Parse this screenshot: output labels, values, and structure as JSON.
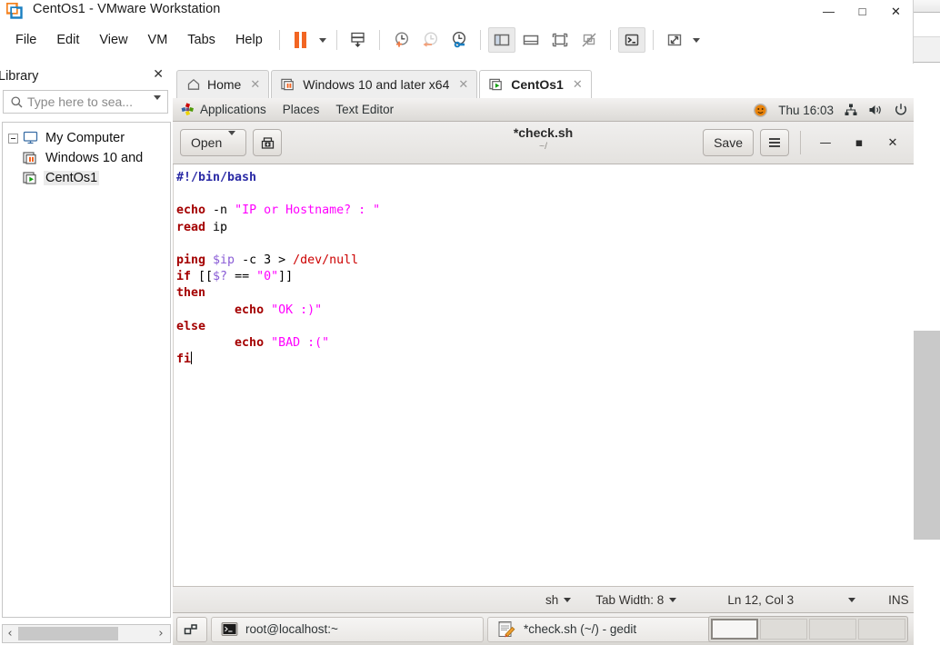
{
  "vmware": {
    "title": "CentOs1 - VMware Workstation",
    "window_buttons": [
      {
        "name": "minimize",
        "glyph": "—"
      },
      {
        "name": "maximize",
        "glyph": "□"
      },
      {
        "name": "close",
        "glyph": "✕"
      }
    ],
    "menus": [
      "File",
      "Edit",
      "View",
      "VM",
      "Tabs",
      "Help"
    ],
    "toolbar_icons": [
      "pause-icon",
      "power-dropdown-caret",
      "snapshot-manager-icon",
      "take-snapshot-icon",
      "revert-snapshot-icon",
      "manage-snapshots-icon",
      "show-library-icon",
      "show-thumbnails-icon",
      "full-screen-icon",
      "unity-mode-icon",
      "console-view-icon",
      "stretch-guest-icon",
      "stretch-dropdown-caret"
    ]
  },
  "library": {
    "title": "Library",
    "close_label": "✕",
    "search_placeholder": "Type here to sea...",
    "tree": [
      {
        "label": "My Computer",
        "icon": "computer-icon",
        "level": 0,
        "selected": false
      },
      {
        "label": "Windows 10 and",
        "icon": "vm-suspended-icon",
        "level": 1,
        "selected": false
      },
      {
        "label": "CentOs1",
        "icon": "vm-running-icon",
        "level": 1,
        "selected": true
      }
    ],
    "scroll_left": "‹",
    "scroll_right": "›"
  },
  "tabs": [
    {
      "label": "Home",
      "icon": "home-icon",
      "active": false,
      "close": "✕"
    },
    {
      "label": "Windows 10 and later x64",
      "icon": "vm-suspended-icon",
      "active": false,
      "close": "✕"
    },
    {
      "label": "CentOs1",
      "icon": "vm-running-icon",
      "active": true,
      "close": "✕"
    }
  ],
  "guest": {
    "panel": {
      "applications": "Applications",
      "places": "Places",
      "app_name": "Text Editor",
      "clock": "Thu 16:03",
      "tray_icons": [
        "user-avatar-icon",
        "network-icon",
        "volume-icon",
        "power-icon"
      ]
    },
    "gedit": {
      "open_label": "Open",
      "open_caret": "▾",
      "new_doc_icon": "new-document-icon",
      "title": "*check.sh",
      "subtitle": "~/",
      "save_label": "Save",
      "menu_icon": "hamburger-menu-icon",
      "window_buttons": [
        {
          "name": "minimize",
          "glyph": "—"
        },
        {
          "name": "maximize",
          "glyph": "▪"
        },
        {
          "name": "close",
          "glyph": "✕"
        }
      ],
      "code_lines": [
        [
          {
            "t": "#!/bin/bash",
            "c": "sb"
          }
        ],
        [],
        [
          {
            "t": "echo",
            "c": "k"
          },
          {
            "t": " -n ",
            "c": "n"
          },
          {
            "t": "\"IP or Hostname? : \"",
            "c": "s"
          }
        ],
        [
          {
            "t": "read",
            "c": "k"
          },
          {
            "t": " ip",
            "c": "n"
          }
        ],
        [],
        [
          {
            "t": "ping",
            "c": "k"
          },
          {
            "t": " ",
            "c": "n"
          },
          {
            "t": "$ip",
            "c": "v"
          },
          {
            "t": " -c 3 > ",
            "c": "n"
          },
          {
            "t": "/dev/null",
            "c": "p"
          }
        ],
        [
          {
            "t": "if",
            "c": "k"
          },
          {
            "t": " [[",
            "c": "n"
          },
          {
            "t": "$?",
            "c": "v"
          },
          {
            "t": " == ",
            "c": "n"
          },
          {
            "t": "\"0\"",
            "c": "s"
          },
          {
            "t": "]]",
            "c": "n"
          }
        ],
        [
          {
            "t": "then",
            "c": "k"
          }
        ],
        [
          {
            "t": "        ",
            "c": "n"
          },
          {
            "t": "echo",
            "c": "k"
          },
          {
            "t": " ",
            "c": "n"
          },
          {
            "t": "\"OK :)\"",
            "c": "s"
          }
        ],
        [
          {
            "t": "else",
            "c": "k"
          }
        ],
        [
          {
            "t": "        ",
            "c": "n"
          },
          {
            "t": "echo",
            "c": "k"
          },
          {
            "t": " ",
            "c": "n"
          },
          {
            "t": "\"BAD :(\"",
            "c": "s"
          }
        ],
        [
          {
            "t": "fi",
            "c": "k"
          }
        ]
      ],
      "status": {
        "language": "sh",
        "tab_width": "Tab Width: 8",
        "position": "Ln 12, Col 3",
        "insert_mode": "INS"
      }
    },
    "taskbar": {
      "show_desktop_icon": "show-desktop-icon",
      "tasks": [
        {
          "label": "root@localhost:~",
          "icon": "terminal-icon"
        },
        {
          "label": "*check.sh (~/) - gedit",
          "icon": "gedit-icon"
        }
      ],
      "workspaces": [
        {
          "index": 1,
          "active": true
        },
        {
          "index": 2,
          "active": false
        },
        {
          "index": 3,
          "active": false
        },
        {
          "index": 4,
          "active": false
        }
      ]
    }
  },
  "colors": {
    "accent_orange": "#f26522",
    "keyword": "#a40000",
    "string": "#ff00ff",
    "variable": "#8a5cd6",
    "path": "#cc0000",
    "shebang": "#2a2aa5"
  }
}
